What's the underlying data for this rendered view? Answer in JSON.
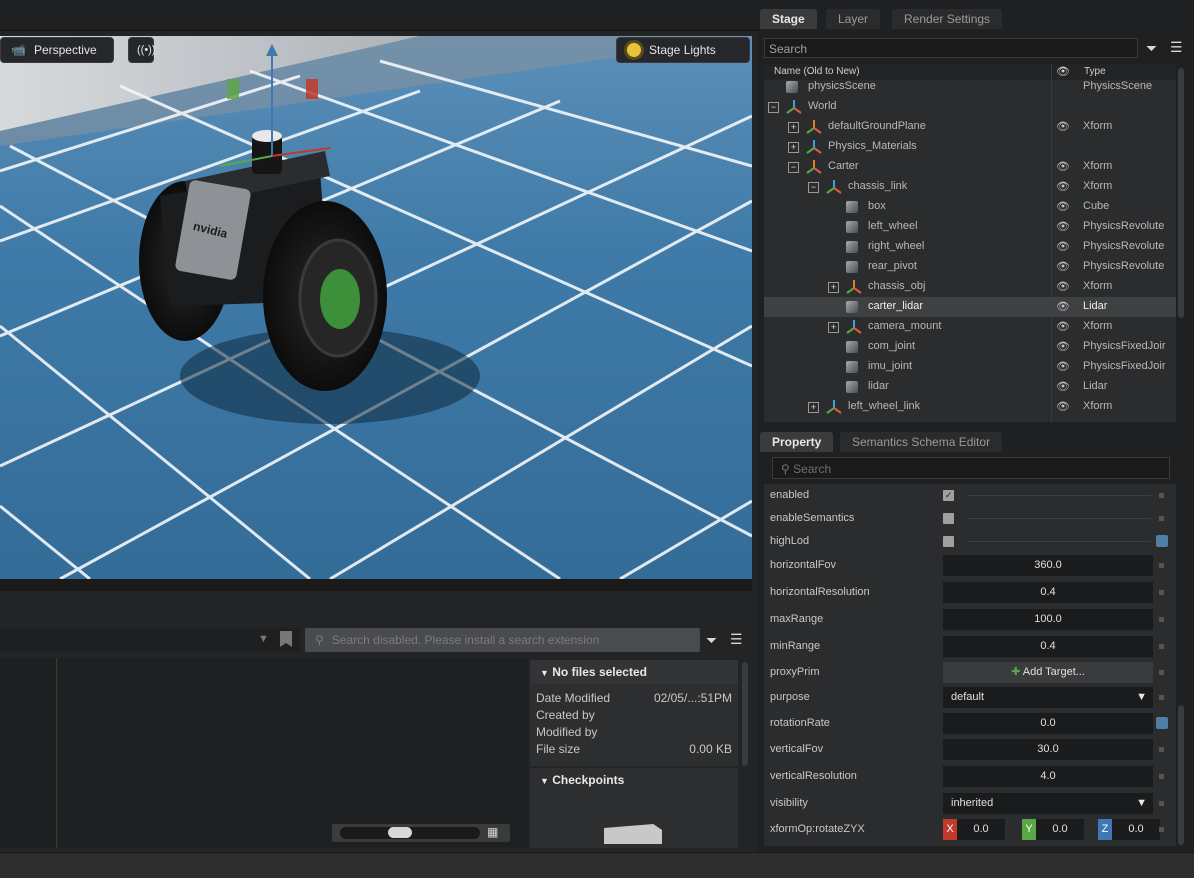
{
  "viewport": {
    "camera_label": "Perspective",
    "lights_label": "Stage Lights",
    "logo_text": "nvidia",
    "icons": [
      "camera-icon",
      "broadcast-icon",
      "sun-icon"
    ]
  },
  "content_browser": {
    "search_placeholder": "Search disabled. Please install a search extension",
    "no_files_title": "No files selected",
    "info": [
      {
        "label": "Date Modified",
        "value": "02/05/...:51PM"
      },
      {
        "label": "Created by",
        "value": ""
      },
      {
        "label": "Modified by",
        "value": ""
      },
      {
        "label": "File size",
        "value": "0.00 KB"
      }
    ],
    "checkpoints_title": "Checkpoints"
  },
  "stage": {
    "tabs": [
      "Stage",
      "Layer",
      "Render Settings"
    ],
    "search_placeholder": "Search",
    "col_name": "Name (Old to New)",
    "col_type": "Type",
    "rows": [
      {
        "name": "physicsScene",
        "type": "PhysicsScene",
        "icon": "cube-icon",
        "depth": 0,
        "expander": "",
        "eye": false
      },
      {
        "name": "World",
        "type": "",
        "icon": "xform-icon",
        "depth": 0,
        "expander": "−",
        "eye": false
      },
      {
        "name": "defaultGroundPlane",
        "type": "Xform",
        "icon": "xform-orange-icon",
        "depth": 1,
        "expander": "+",
        "eye": true
      },
      {
        "name": "Physics_Materials",
        "type": "",
        "icon": "xform-icon",
        "depth": 1,
        "expander": "+",
        "eye": false
      },
      {
        "name": "Carter",
        "type": "Xform",
        "icon": "xform-orange-icon",
        "depth": 1,
        "expander": "−",
        "eye": true
      },
      {
        "name": "chassis_link",
        "type": "Xform",
        "icon": "xform-icon",
        "depth": 2,
        "expander": "−",
        "eye": true
      },
      {
        "name": "box",
        "type": "Cube",
        "icon": "cube-icon",
        "depth": 3,
        "expander": "",
        "eye": true
      },
      {
        "name": "left_wheel",
        "type": "PhysicsRevolute",
        "icon": "cube-icon",
        "depth": 3,
        "expander": "",
        "eye": true
      },
      {
        "name": "right_wheel",
        "type": "PhysicsRevolute",
        "icon": "cube-icon",
        "depth": 3,
        "expander": "",
        "eye": true
      },
      {
        "name": "rear_pivot",
        "type": "PhysicsRevolute",
        "icon": "cube-icon",
        "depth": 3,
        "expander": "",
        "eye": true
      },
      {
        "name": "chassis_obj",
        "type": "Xform",
        "icon": "xform-orange-icon",
        "depth": 3,
        "expander": "+",
        "eye": true
      },
      {
        "name": "carter_lidar",
        "type": "Lidar",
        "icon": "cube-icon",
        "depth": 3,
        "expander": "",
        "eye": true,
        "selected": true
      },
      {
        "name": "camera_mount",
        "type": "Xform",
        "icon": "xform-icon",
        "depth": 3,
        "expander": "+",
        "eye": true
      },
      {
        "name": "com_joint",
        "type": "PhysicsFixedJoir",
        "icon": "cube-icon",
        "depth": 3,
        "expander": "",
        "eye": true
      },
      {
        "name": "imu_joint",
        "type": "PhysicsFixedJoir",
        "icon": "cube-icon",
        "depth": 3,
        "expander": "",
        "eye": true
      },
      {
        "name": "lidar",
        "type": "Lidar",
        "icon": "cube-icon",
        "depth": 3,
        "expander": "",
        "eye": true
      },
      {
        "name": "left_wheel_link",
        "type": "Xform",
        "icon": "xform-icon",
        "depth": 2,
        "expander": "+",
        "eye": true
      }
    ]
  },
  "property": {
    "tabs": [
      "Property",
      "Semantics Schema Editor"
    ],
    "search_placeholder": "Search",
    "fields": [
      {
        "label": "enabled",
        "kind": "check",
        "checked": true
      },
      {
        "label": "enableSemantics",
        "kind": "check",
        "checked": false
      },
      {
        "label": "highLod",
        "kind": "check",
        "checked": false,
        "keyed": true
      },
      {
        "label": "horizontalFov",
        "kind": "num",
        "value": "360.0"
      },
      {
        "label": "horizontalResolution",
        "kind": "num",
        "value": "0.4"
      },
      {
        "label": "maxRange",
        "kind": "num",
        "value": "100.0"
      },
      {
        "label": "minRange",
        "kind": "num",
        "value": "0.4"
      },
      {
        "label": "proxyPrim",
        "kind": "button",
        "value": "Add Target..."
      },
      {
        "label": "purpose",
        "kind": "select",
        "value": "default"
      },
      {
        "label": "rotationRate",
        "kind": "num",
        "value": "0.0",
        "keyed": true
      },
      {
        "label": "verticalFov",
        "kind": "num",
        "value": "30.0"
      },
      {
        "label": "verticalResolution",
        "kind": "num",
        "value": "4.0"
      },
      {
        "label": "visibility",
        "kind": "select",
        "value": "inherited"
      },
      {
        "label": "xformOp:rotateZYX",
        "kind": "xyz",
        "x": "0.0",
        "y": "0.0",
        "z": "0.0"
      }
    ]
  },
  "colors": {
    "x_axis": "#c0392b",
    "y_axis": "#5aa845",
    "z_axis": "#3f78b5",
    "selection": "#3e4042",
    "floor": "#3b77a6"
  }
}
